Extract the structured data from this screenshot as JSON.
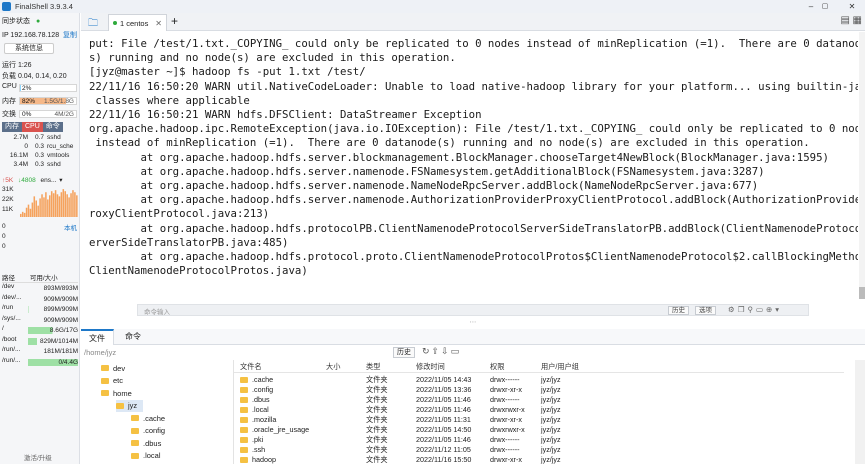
{
  "window": {
    "title": "FinalShell 3.9.3.4",
    "min": "–",
    "max": "▢",
    "close": "✕"
  },
  "sidebar": {
    "sync_status": "同步状态",
    "status_dot": "●",
    "ip": "IP 192.168.78.128",
    "copy": "复制",
    "sysinfo_button": "系统信息",
    "uptime": "运行 1:26",
    "load": "负载 0.04, 0.14, 0.20",
    "cpu": {
      "label": "CPU",
      "value": "2%",
      "percent": 2
    },
    "mem": {
      "label": "内存",
      "value": "82%",
      "detail": "1.5G/1.8G",
      "percent": 82
    },
    "swap": {
      "label": "交换",
      "value": "0%",
      "detail": "4M/2G",
      "percent": 0
    },
    "proc_tabs": [
      "内存",
      "CPU",
      "命令"
    ],
    "procs": [
      {
        "mem": "2.7M",
        "cpu": "0.7",
        "cmd": "sshd"
      },
      {
        "mem": "0",
        "cpu": "0.3",
        "cmd": "rcu_sche"
      },
      {
        "mem": "16.1M",
        "cpu": "0.3",
        "cmd": "vmtools"
      },
      {
        "mem": "3.4M",
        "cpu": "0.3",
        "cmd": "sshd"
      }
    ],
    "net": {
      "up": "↑5K",
      "down": "↓4808",
      "iface": "ens...",
      "scale": [
        "31K",
        "22K",
        "11K"
      ],
      "bars": [
        3,
        5,
        4,
        9,
        12,
        8,
        14,
        20,
        16,
        11,
        18,
        22,
        19,
        24,
        17,
        21,
        25,
        23,
        26,
        22,
        20,
        24,
        27,
        25,
        22,
        19,
        23,
        26,
        24,
        21
      ]
    },
    "io": {
      "scale": [
        "0",
        "0",
        "0"
      ],
      "label": "本机"
    },
    "disk_header": {
      "path": "路径",
      "avail": "可用/大小"
    },
    "disks": [
      {
        "path": "/dev",
        "size": "893M/893M",
        "used": 0
      },
      {
        "path": "/dev/...",
        "size": "909M/909M",
        "used": 0
      },
      {
        "path": "/run",
        "size": "899M/909M",
        "used": 1
      },
      {
        "path": "/sys/...",
        "size": "909M/909M",
        "used": 0
      },
      {
        "path": "/",
        "size": "8.6G/17G",
        "used": 49
      },
      {
        "path": "/boot",
        "size": "829M/1014M",
        "used": 18
      },
      {
        "path": "/run/...",
        "size": "181M/181M",
        "used": 0
      },
      {
        "path": "/run/...",
        "size": "0/4.4G",
        "used": 100
      }
    ],
    "activate": "激活/升级"
  },
  "tabs": {
    "folder_icon": "folder-icon",
    "session_label": "1 centos",
    "add": "+"
  },
  "terminal": {
    "lines": [
      "put: File /test/1.txt._COPYING_ could only be replicated to 0 nodes instead of minReplication (=1).  There are 0 datanode(",
      "s) running and no node(s) are excluded in this operation.",
      "[jyz@master ~]$ hadoop fs -put 1.txt /test/",
      "22/11/16 16:50:20 WARN util.NativeCodeLoader: Unable to load native-hadoop library for your platform... using builtin-java",
      " classes where applicable",
      "22/11/16 16:50:21 WARN hdfs.DFSClient: DataStreamer Exception",
      "org.apache.hadoop.ipc.RemoteException(java.io.IOException): File /test/1.txt._COPYING_ could only be replicated to 0 nodes",
      " instead of minReplication (=1).  There are 0 datanode(s) running and no node(s) are excluded in this operation.",
      "        at org.apache.hadoop.hdfs.server.blockmanagement.BlockManager.chooseTarget4NewBlock(BlockManager.java:1595)",
      "        at org.apache.hadoop.hdfs.server.namenode.FSNamesystem.getAdditionalBlock(FSNamesystem.java:3287)",
      "        at org.apache.hadoop.hdfs.server.namenode.NameNodeRpcServer.addBlock(NameNodeRpcServer.java:677)",
      "        at org.apache.hadoop.hdfs.server.namenode.AuthorizationProviderProxyClientProtocol.addBlock(AuthorizationProviderP",
      "roxyClientProtocol.java:213)",
      "        at org.apache.hadoop.hdfs.protocolPB.ClientNamenodeProtocolServerSideTranslatorPB.addBlock(ClientNamenodeProtocolS",
      "erverSideTranslatorPB.java:485)",
      "        at org.apache.hadoop.hdfs.protocol.proto.ClientNamenodeProtocolProtos$ClientNamenodeProtocol$2.callBlockingMethod(",
      "ClientNamenodeProtocolProtos.java)"
    ]
  },
  "cmdbar": {
    "placeholder": "命令输入",
    "history": "历史",
    "options": "选项"
  },
  "bottom_tabs": [
    "文件",
    "命令"
  ],
  "filebrowser": {
    "path": "/home/jyz",
    "history": "历史",
    "tree": [
      {
        "name": "dev",
        "indent": 0
      },
      {
        "name": "etc",
        "indent": 0
      },
      {
        "name": "home",
        "indent": 0
      },
      {
        "name": "jyz",
        "indent": 1
      },
      {
        "name": ".cache",
        "indent": 2
      },
      {
        "name": ".config",
        "indent": 2
      },
      {
        "name": ".dbus",
        "indent": 2
      },
      {
        "name": ".local",
        "indent": 2
      }
    ],
    "columns": [
      "文件名",
      "大小",
      "类型",
      "修改时间",
      "权限",
      "用户/用户组"
    ],
    "files": [
      {
        "name": ".cache",
        "size": "",
        "type": "文件夹",
        "mtime": "2022/11/05 14:43",
        "perm": "drwx------",
        "owner": "jyz/jyz"
      },
      {
        "name": ".config",
        "size": "",
        "type": "文件夹",
        "mtime": "2022/11/05 13:36",
        "perm": "drwxr-xr-x",
        "owner": "jyz/jyz"
      },
      {
        "name": ".dbus",
        "size": "",
        "type": "文件夹",
        "mtime": "2022/11/05 11:46",
        "perm": "drwx------",
        "owner": "jyz/jyz"
      },
      {
        "name": ".local",
        "size": "",
        "type": "文件夹",
        "mtime": "2022/11/05 11:46",
        "perm": "drwxrwxr-x",
        "owner": "jyz/jyz"
      },
      {
        "name": ".mozilla",
        "size": "",
        "type": "文件夹",
        "mtime": "2022/11/05 11:31",
        "perm": "drwxr-xr-x",
        "owner": "jyz/jyz"
      },
      {
        "name": ".oracle_jre_usage",
        "size": "",
        "type": "文件夹",
        "mtime": "2022/11/05 14:50",
        "perm": "drwxrwxr-x",
        "owner": "jyz/jyz"
      },
      {
        "name": ".pki",
        "size": "",
        "type": "文件夹",
        "mtime": "2022/11/05 11:46",
        "perm": "drwx------",
        "owner": "jyz/jyz"
      },
      {
        "name": ".ssh",
        "size": "",
        "type": "文件夹",
        "mtime": "2022/11/12 11:05",
        "perm": "drwx------",
        "owner": "jyz/jyz"
      },
      {
        "name": "hadoop",
        "size": "",
        "type": "文件夹",
        "mtime": "2022/11/16 15:50",
        "perm": "drwxr-xr-x",
        "owner": "jyz/jyz"
      }
    ]
  },
  "colors": {
    "accent": "#1e78c8",
    "mem_bar": "#f5b889",
    "ok_green": "#2eaa3c",
    "disk_bar": "#9ee0a5"
  }
}
